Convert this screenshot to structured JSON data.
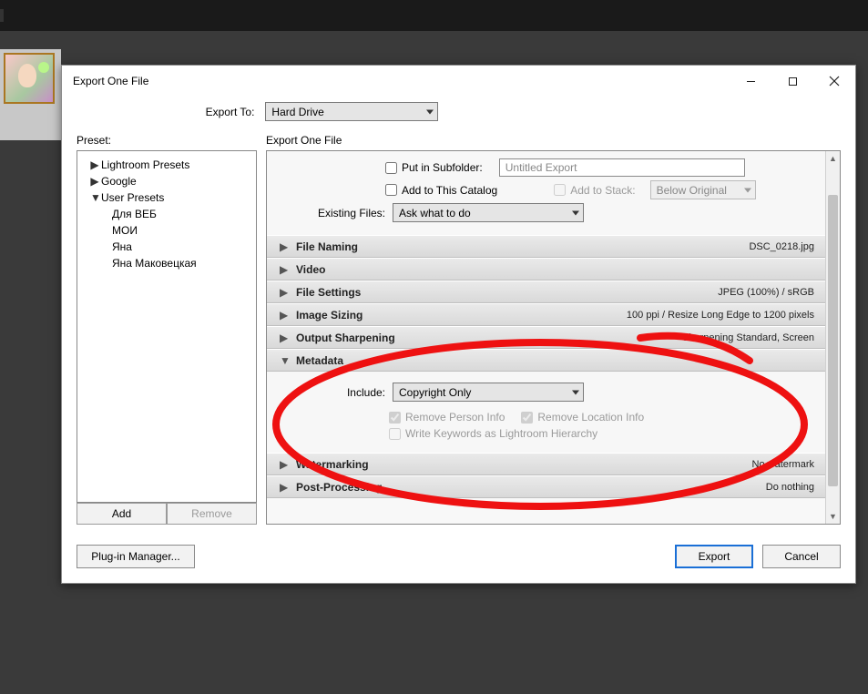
{
  "dialog": {
    "title": "Export One File",
    "export_to_label": "Export To:",
    "export_to_value": "Hard Drive",
    "preset_label": "Preset:",
    "right_header_label": "Export One File"
  },
  "presets": {
    "tree": [
      {
        "label": "Lightroom Presets",
        "expanded": false
      },
      {
        "label": "Google",
        "expanded": false
      },
      {
        "label": "User Presets",
        "expanded": true,
        "children": [
          {
            "label": "Для ВЕБ"
          },
          {
            "label": "МОИ"
          },
          {
            "label": "Яна"
          },
          {
            "label": "Яна Маковецкая"
          }
        ]
      }
    ],
    "add_label": "Add",
    "remove_label": "Remove"
  },
  "top_area": {
    "put_in_subfolder_label": "Put in Subfolder:",
    "put_in_subfolder_checked": false,
    "subfolder_text": "Untitled Export",
    "add_to_catalog_label": "Add to This Catalog",
    "add_to_catalog_checked": false,
    "add_to_stack_label": "Add to Stack:",
    "add_to_stack_checked": false,
    "stack_position": "Below Original",
    "existing_files_label": "Existing Files:",
    "existing_files_value": "Ask what to do"
  },
  "sections": {
    "file_naming": {
      "title": "File Naming",
      "summary": "DSC_0218.jpg"
    },
    "video": {
      "title": "Video",
      "summary": ""
    },
    "file_settings": {
      "title": "File Settings",
      "summary": "JPEG (100%) / sRGB"
    },
    "image_sizing": {
      "title": "Image Sizing",
      "summary": "100 ppi / Resize Long Edge to 1200 pixels"
    },
    "output_sharpening": {
      "title": "Output Sharpening",
      "summary": "Sharpening Standard, Screen"
    },
    "metadata": {
      "title": "Metadata",
      "summary": ""
    },
    "watermarking": {
      "title": "Watermarking",
      "summary": "No watermark"
    },
    "post_processing": {
      "title": "Post-Processing",
      "summary": "Do nothing"
    }
  },
  "metadata_panel": {
    "include_label": "Include:",
    "include_value": "Copyright Only",
    "remove_person_label": "Remove Person Info",
    "remove_person_checked": true,
    "remove_location_label": "Remove Location Info",
    "remove_location_checked": true,
    "write_keywords_label": "Write Keywords as Lightroom Hierarchy",
    "write_keywords_checked": false
  },
  "buttons": {
    "plugin_manager": "Plug-in Manager...",
    "export": "Export",
    "cancel": "Cancel"
  }
}
